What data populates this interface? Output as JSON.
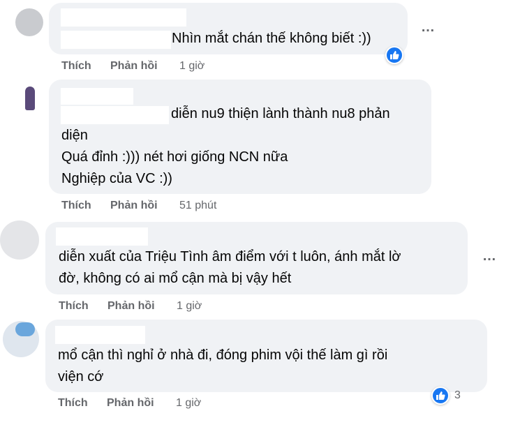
{
  "comments": [
    {
      "lines": [
        "Nhìn mắt chán thế không biết :))"
      ],
      "actions": {
        "like": "Thích",
        "reply": "Phản hồi",
        "time": "1 giờ"
      }
    },
    {
      "lines": [
        "diễn nu9 thiện lành thành nu8 phản",
        "diện",
        "Quá đỉnh :))) nét hơi giống NCN nữa",
        "Nghiệp của VC :))"
      ],
      "actions": {
        "like": "Thích",
        "reply": "Phản hồi",
        "time": "51 phút"
      }
    },
    {
      "lines": [
        "diễn xuất của Triệu Tình âm điểm với t luôn, ánh mắt lờ",
        "đờ, không có ai mổ cận mà bị vậy hết"
      ],
      "actions": {
        "like": "Thích",
        "reply": "Phản hồi",
        "time": "1 giờ"
      }
    },
    {
      "lines": [
        "mổ cận thì nghỉ ở nhà đi, đóng phim vội thế làm gì rồi",
        "viện cớ"
      ],
      "actions": {
        "like": "Thích",
        "reply": "Phản hồi",
        "time": "1 giờ"
      },
      "reaction_count": "3"
    }
  ],
  "more_icon": "…",
  "colors": {
    "bubble": "#f0f2f5",
    "like_blue": "#1877f2",
    "meta_gray": "#65676b"
  }
}
